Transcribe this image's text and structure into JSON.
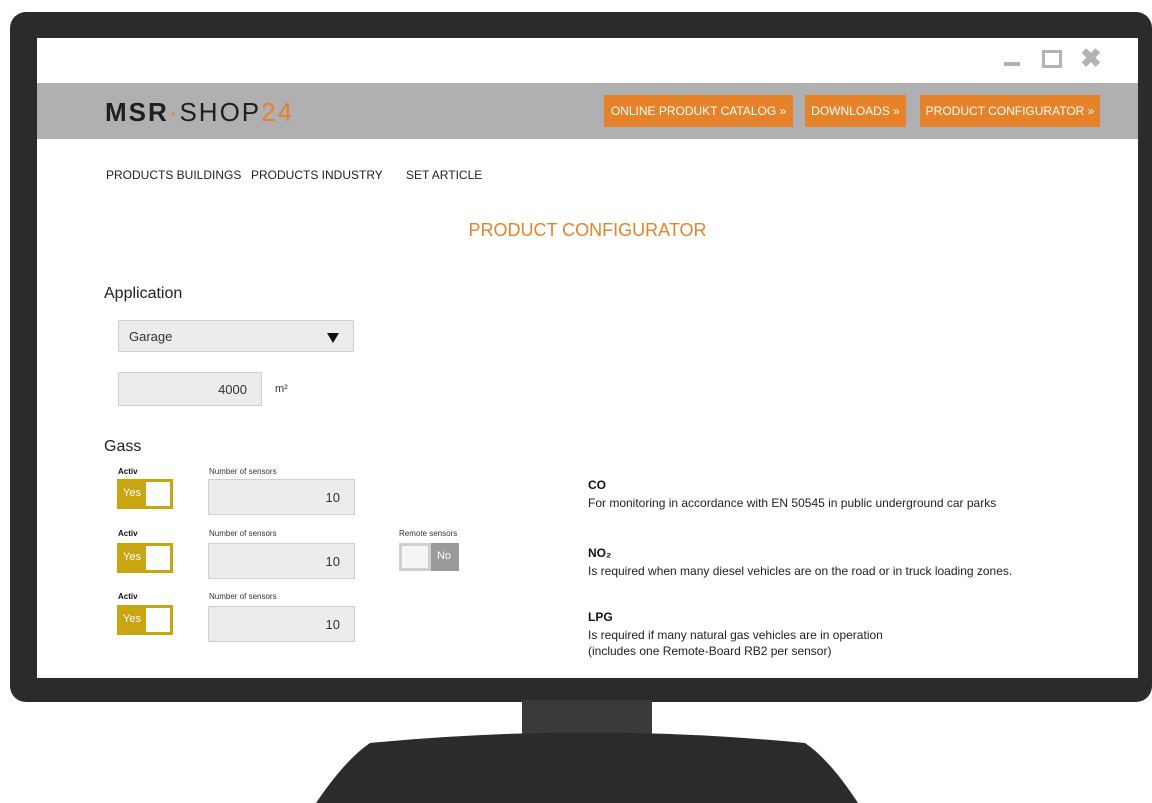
{
  "window": {
    "minimize_icon": "minimize-icon",
    "maximize_icon": "maximize-icon",
    "close_icon": "close-icon"
  },
  "header": {
    "logo_part1": "MSR",
    "logo_dot": "·",
    "logo_part2": "SHOP",
    "logo_num": "24",
    "buttons": [
      "ONLINE PRODUKT CATALOG »",
      "DOWNLOADS »",
      "PRODUCT CONFIGURATOR »"
    ]
  },
  "subnav": [
    "PRODUCTS BUILDINGS",
    "PRODUCTS INDUSTRY",
    "SET ARTICLE"
  ],
  "page_title": "PRODUCT CONFIGURATOR",
  "application": {
    "title": "Application",
    "select_value": "Garage",
    "area_value": "4000",
    "area_unit": "m²"
  },
  "gas": {
    "title": "Gass",
    "rows": [
      {
        "activ_label": "Activ",
        "toggle": "Yes",
        "count_label": "Number of sensors",
        "count": "10"
      },
      {
        "activ_label": "Activ",
        "toggle": "Yes",
        "count_label": "Number of sensors",
        "count": "10",
        "remote_label": "Remote sensors",
        "remote_toggle": "No"
      },
      {
        "activ_label": "Activ",
        "toggle": "Yes",
        "count_label": "Number of sensors",
        "count": "10"
      }
    ]
  },
  "descriptions": [
    {
      "title": "CO",
      "text": "For monitoring in accordance with EN 50545 in public underground car parks"
    },
    {
      "title": "NO₂",
      "text": "Is required when many diesel vehicles are on the road or in truck loading zones."
    },
    {
      "title": "LPG",
      "text": "Is required if many natural gas vehicles are in operation",
      "text2": "(includes one Remote-Board RB2 per sensor)"
    }
  ],
  "colors": {
    "accent": "#e6832a",
    "toggle_on": "#c9a512",
    "header_bg": "#b0b0b2",
    "bezel": "#2b2b2b"
  }
}
